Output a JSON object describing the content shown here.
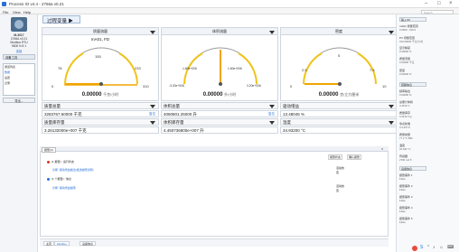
{
  "window": {
    "title": "Process IO v4.4 - 2766a v0.21",
    "search_placeholder": "Search"
  },
  "menu": [
    "File",
    "View",
    "Help"
  ],
  "left": {
    "device_name": "M-3017",
    "device_lines": [
      "2766A v0.21",
      "Modbus RTU",
      "9600 N 8 1"
    ],
    "connect_label": "连接",
    "section": "设备工具",
    "list_header": "通道列表",
    "items": [
      "数据",
      "设置",
      "记录"
    ],
    "button": "导出..."
  },
  "tab": {
    "label": "过程变量"
  },
  "gauges": [
    {
      "header": "质量流量",
      "sub": "mA01, FD",
      "ticks": [
        "78",
        "155",
        "233",
        "0",
        "310"
      ],
      "reading": "0.00000",
      "unit": "千克/小时",
      "value_fraction": 0.0
    },
    {
      "header": "体积流量",
      "sub": "",
      "ticks": [
        "-1.60e+006",
        "1.60e+006",
        "-3.20e+006",
        "3.20e+006"
      ],
      "reading": "0.00000",
      "unit": "升/小时",
      "value_fraction": 0.5
    },
    {
      "header": "密度",
      "sub": "",
      "ticks": [
        "2.5",
        "5",
        "7.5",
        "0",
        "10"
      ],
      "reading": "0.00000",
      "unit": "克/立方厘米",
      "value_fraction": 0.0
    }
  ],
  "info": [
    {
      "label": "质量总量",
      "value": "3283767.50000 千克",
      "link": "复位"
    },
    {
      "label": "体积总量",
      "value": "4060801.25000 升",
      "link": "复位"
    },
    {
      "label": "驱动增益",
      "value": "13.48046 %",
      "link": ""
    },
    {
      "label": "质量库存量",
      "value": "3.26132000e+007 千克",
      "link": ""
    },
    {
      "label": "体积库存量",
      "value": "4.450736800e+007 升",
      "link": ""
    },
    {
      "label": "温度",
      "value": "34.93200 °C",
      "link": ""
    }
  ],
  "log": {
    "tab": "报警(4)",
    "filters": [
      "报警状态",
      "确认报警"
    ],
    "groups": [
      {
        "title": "(1 报警) : 运行状态",
        "color": "#d9342b",
        "item": "诊断: 驱动增益超出(发送故障诊断)",
        "col1": "活动的",
        "col2": "否"
      },
      {
        "title": "(1 个报警) : 信息",
        "color": "#2a6fd6",
        "item": "诊断: 驱动增益超限",
        "col1": "活动的",
        "col2": "否"
      }
    ]
  },
  "bottom_tabs": [
    "主页",
    "Modbus",
    "设备信息"
  ],
  "right": {
    "sections": [
      "输入/IO",
      "回路信息",
      "设备信息"
    ],
    "items": [
      {
        "k": "mA01 测量范围",
        "v": "0.0000 - 310.0"
      },
      {
        "k": "PV 测量范围",
        "v": "310.00000 千克/小时"
      },
      {
        "k": "显示精度",
        "v": "0.00000 %"
      },
      {
        "k": "质量流量",
        "v": "0.00000 千克"
      },
      {
        "k": "密度",
        "v": "0.00000 %"
      },
      {
        "k": "频率输出",
        "v": "0.00000 %"
      },
      {
        "k": "总累计体积",
        "v": "4.45 E7 L"
      },
      {
        "k": "质量库存",
        "v": "3.26 E7 kg"
      },
      {
        "k": "零点校准",
        "v": "4.4.457.8"
      },
      {
        "k": "质量常量",
        "v": "77.2 °F Bbh"
      },
      {
        "k": "温度",
        "v": "34.932 °C"
      },
      {
        "k": "传感器",
        "v": "2700 mA 5"
      },
      {
        "k": "报警事件 1",
        "v": "False"
      },
      {
        "k": "报警事件 2",
        "v": "False"
      },
      {
        "k": "报警事件 3",
        "v": "False"
      },
      {
        "k": "报警事件 4",
        "v": "False"
      },
      {
        "k": "报警事件 5",
        "v": "False"
      }
    ]
  }
}
